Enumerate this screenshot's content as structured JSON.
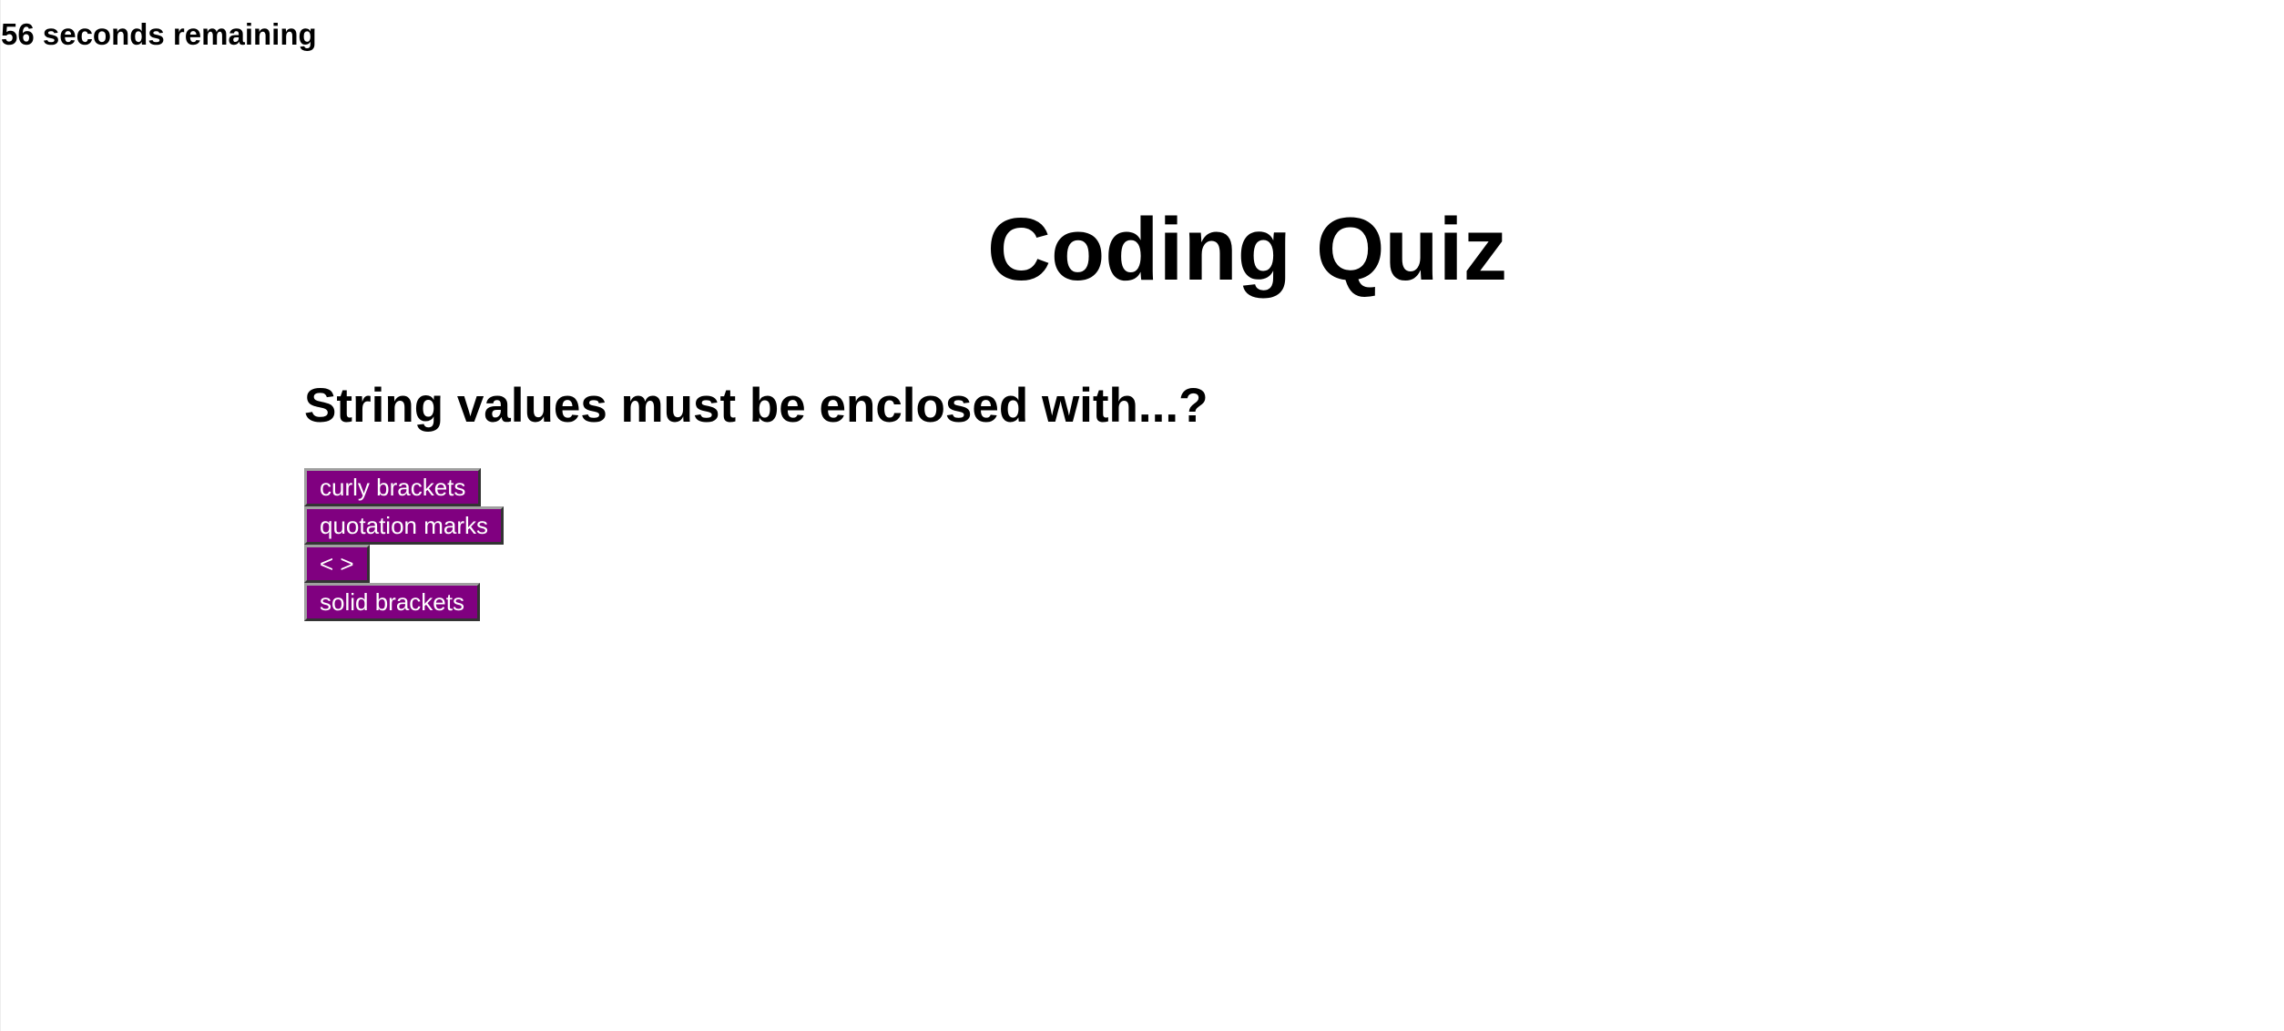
{
  "timer": {
    "text": "56 seconds remaining"
  },
  "quiz": {
    "title": "Coding Quiz",
    "question": "String values must be enclosed with...?",
    "choices": [
      {
        "label": "curly brackets"
      },
      {
        "label": "quotation marks"
      },
      {
        "label": "< >"
      },
      {
        "label": "solid brackets"
      }
    ]
  },
  "colors": {
    "button_background": "#800080",
    "button_text": "#ffffff",
    "page_background": "#ffffff",
    "text": "#000000"
  }
}
